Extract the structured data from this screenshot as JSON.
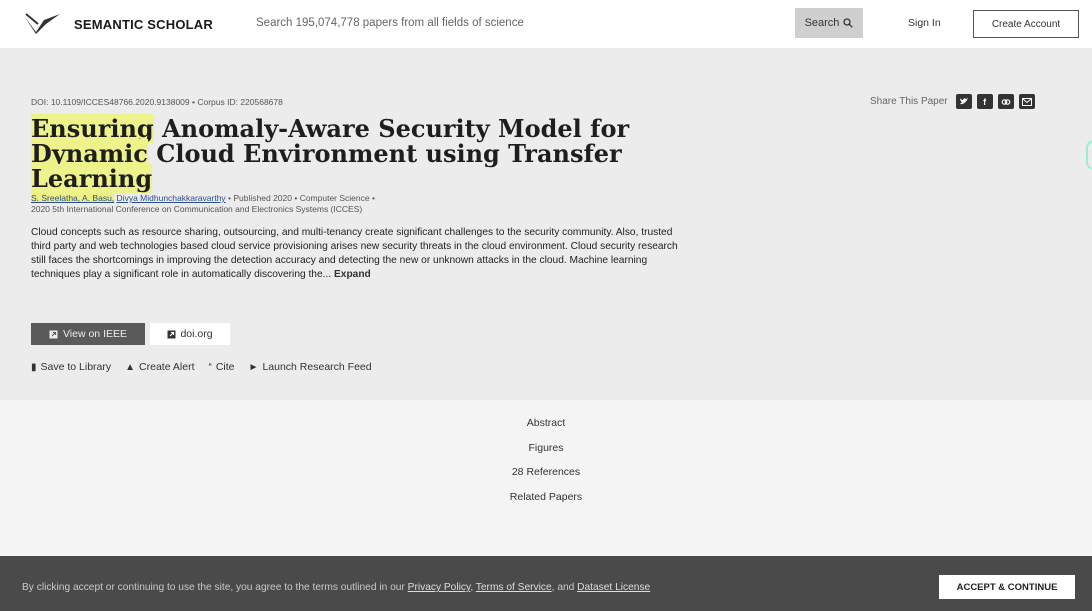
{
  "header": {
    "logo_text": "SEMANTIC SCHOLAR",
    "search_placeholder": "Search 195,074,778 papers from all fields of science",
    "search_button": "Search",
    "sign_in": "Sign In",
    "create_account": "Create Account"
  },
  "paper": {
    "meta_line": "DOI: 10.1109/ICCES48766.2020.9138009 • Corpus ID: 220568678",
    "share_label": "Share This Paper",
    "title_hl": "Ensuring",
    "title_rest": " Anomaly-Aware Security Model for",
    "title_line2_hl": "Dynamic",
    "title_line2_rest": " Cloud Environment using Transfer",
    "title_line3_hl": "Learning",
    "authors_hl": "S. Sreelatha, A. Basu,",
    "authors_rest_name": "Divya Midhunchakkaravarthy",
    "published_line": " • Published 2020 • Computer Science •",
    "venue": "2020 5th International Conference on Communication and Electronics Systems (ICCES)",
    "abstract": "Cloud concepts such as resource sharing, outsourcing, and multi-tenancy create significant challenges to the security community. Also, trusted third party and web technologies based cloud service provisioning arises new security threats in the cloud environment. Cloud security research still faces the shortcomings in improving the detection accuracy and detecting the new or unknown attacks in the cloud. Machine learning techniques play a significant role in automatically discovering the...",
    "expand": "Expand",
    "view_ieee": "View on IEEE",
    "doi_link": "doi.org",
    "actions": {
      "save": "Save to Library",
      "alert": "Create Alert",
      "cite": "Cite",
      "feed": "Launch Research Feed"
    }
  },
  "tabs": [
    "Abstract",
    "Figures",
    "28 References",
    "Related Papers"
  ],
  "cookie": {
    "text_prefix": "By clicking accept or continuing to use the site, you agree to the terms outlined in our ",
    "privacy": "Privacy Policy",
    "sep1": ", ",
    "terms": "Terms of Service",
    "sep2": ", and ",
    "dataset": "Dataset License",
    "accept": "ACCEPT & CONTINUE"
  },
  "icons": {
    "share": [
      "twitter-icon",
      "facebook-icon",
      "link-icon",
      "email-icon"
    ]
  }
}
